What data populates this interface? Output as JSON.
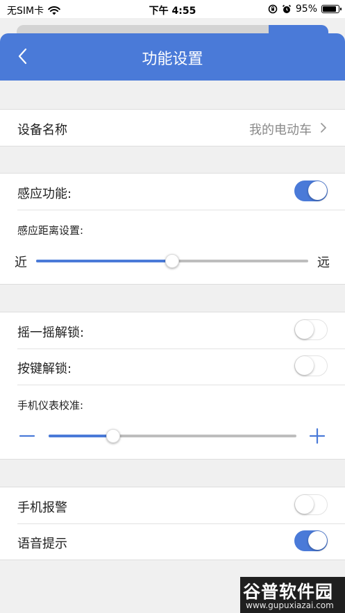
{
  "status_bar": {
    "carrier": "无SIM卡",
    "time": "下午 4:55",
    "battery_percent": "95%",
    "battery_level": 0.95
  },
  "nav": {
    "title": "功能设置",
    "back_icon": "chevron-left-icon"
  },
  "device": {
    "label": "设备名称",
    "value": "我的电动车"
  },
  "sensing": {
    "toggle_label": "感应功能:",
    "toggle_on": true,
    "distance_label": "感应距离设置:",
    "min_label": "近",
    "max_label": "远",
    "distance_level": 0.5
  },
  "unlock": {
    "shake_label": "摇一摇解锁:",
    "shake_on": false,
    "button_label": "按键解锁:",
    "button_on": false,
    "calibration_label": "手机仪表校准:",
    "calibration_level": 0.26
  },
  "alerts": {
    "alarm_label": "手机报警",
    "alarm_on": false,
    "voice_label": "语音提示",
    "voice_on": true
  },
  "watermark": {
    "brand": "谷普软件园",
    "url": "www.gupuxiazai.com"
  },
  "colors": {
    "accent": "#4a7ad8",
    "track": "#bdbdbd",
    "background": "#f0f0f0"
  }
}
